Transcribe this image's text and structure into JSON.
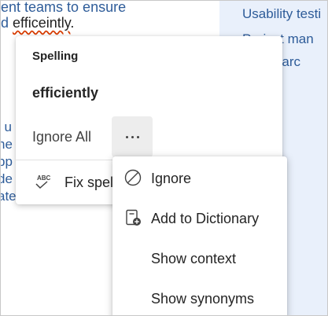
{
  "document": {
    "line1": "ent teams to ensure",
    "line2_prefix": "d ",
    "misspelled_word": "efficeintly",
    "line2_suffix": ".",
    "left_fragments": [
      "l u",
      "ne",
      "pp",
      "de",
      "ate"
    ],
    "right_lines": [
      "Usability testi",
      "Project man",
      "esearc"
    ]
  },
  "spelling_card": {
    "title": "Spelling",
    "suggestion": "efficiently",
    "ignore_all": "Ignore All",
    "fix_spelling": "Fix spel"
  },
  "context_menu": {
    "items": [
      {
        "label": "Ignore",
        "icon": "prohibited-icon"
      },
      {
        "label": "Add to Dictionary",
        "icon": "add-to-dictionary-icon"
      },
      {
        "label": "Show context",
        "icon": ""
      },
      {
        "label": "Show synonyms",
        "icon": ""
      }
    ]
  },
  "colors": {
    "doc_text": "#2e5c99",
    "squiggle": "#d83b01",
    "pane": "#e9f0fb",
    "button_bg": "#ededed"
  }
}
